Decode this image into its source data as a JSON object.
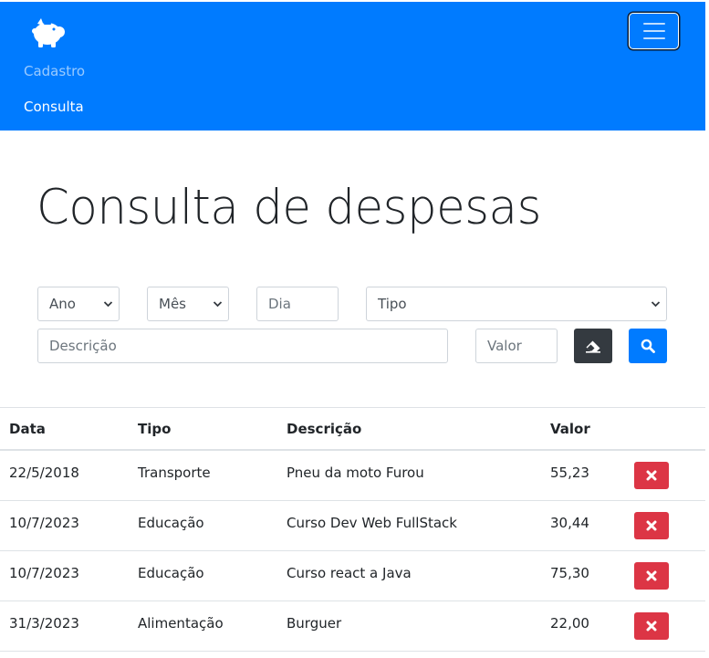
{
  "navbar": {
    "brand_icon": "piggy-bank-icon",
    "toggler_icon": "hamburger-icon",
    "links": [
      {
        "label": "Cadastro",
        "active": false
      },
      {
        "label": "Consulta",
        "active": true
      }
    ],
    "colors": {
      "background": "#007bff"
    }
  },
  "main": {
    "title": "Consulta de despesas"
  },
  "filters": {
    "ano": {
      "value": "Ano"
    },
    "mes": {
      "value": "Mês"
    },
    "dia": {
      "placeholder": "Dia"
    },
    "tipo": {
      "value": "Tipo"
    },
    "descricao": {
      "placeholder": "Descrição"
    },
    "valor": {
      "placeholder": "Valor"
    },
    "clear_button_icon": "eraser-icon",
    "search_button_icon": "search-icon"
  },
  "table": {
    "headers": [
      "Data",
      "Tipo",
      "Descrição",
      "Valor"
    ],
    "rows": [
      {
        "data": "22/5/2018",
        "tipo": "Transporte",
        "descricao": "Pneu da moto Furou",
        "valor": "55,23"
      },
      {
        "data": "10/7/2023",
        "tipo": "Educação",
        "descricao": "Curso Dev Web FullStack",
        "valor": "30,44"
      },
      {
        "data": "10/7/2023",
        "tipo": "Educação",
        "descricao": "Curso react a Java",
        "valor": "75,30"
      },
      {
        "data": "31/3/2023",
        "tipo": "Alimentação",
        "descricao": "Burguer",
        "valor": "22,00"
      }
    ],
    "delete_button_icon": "times-icon",
    "colors": {
      "delete": "#dc3545"
    }
  }
}
